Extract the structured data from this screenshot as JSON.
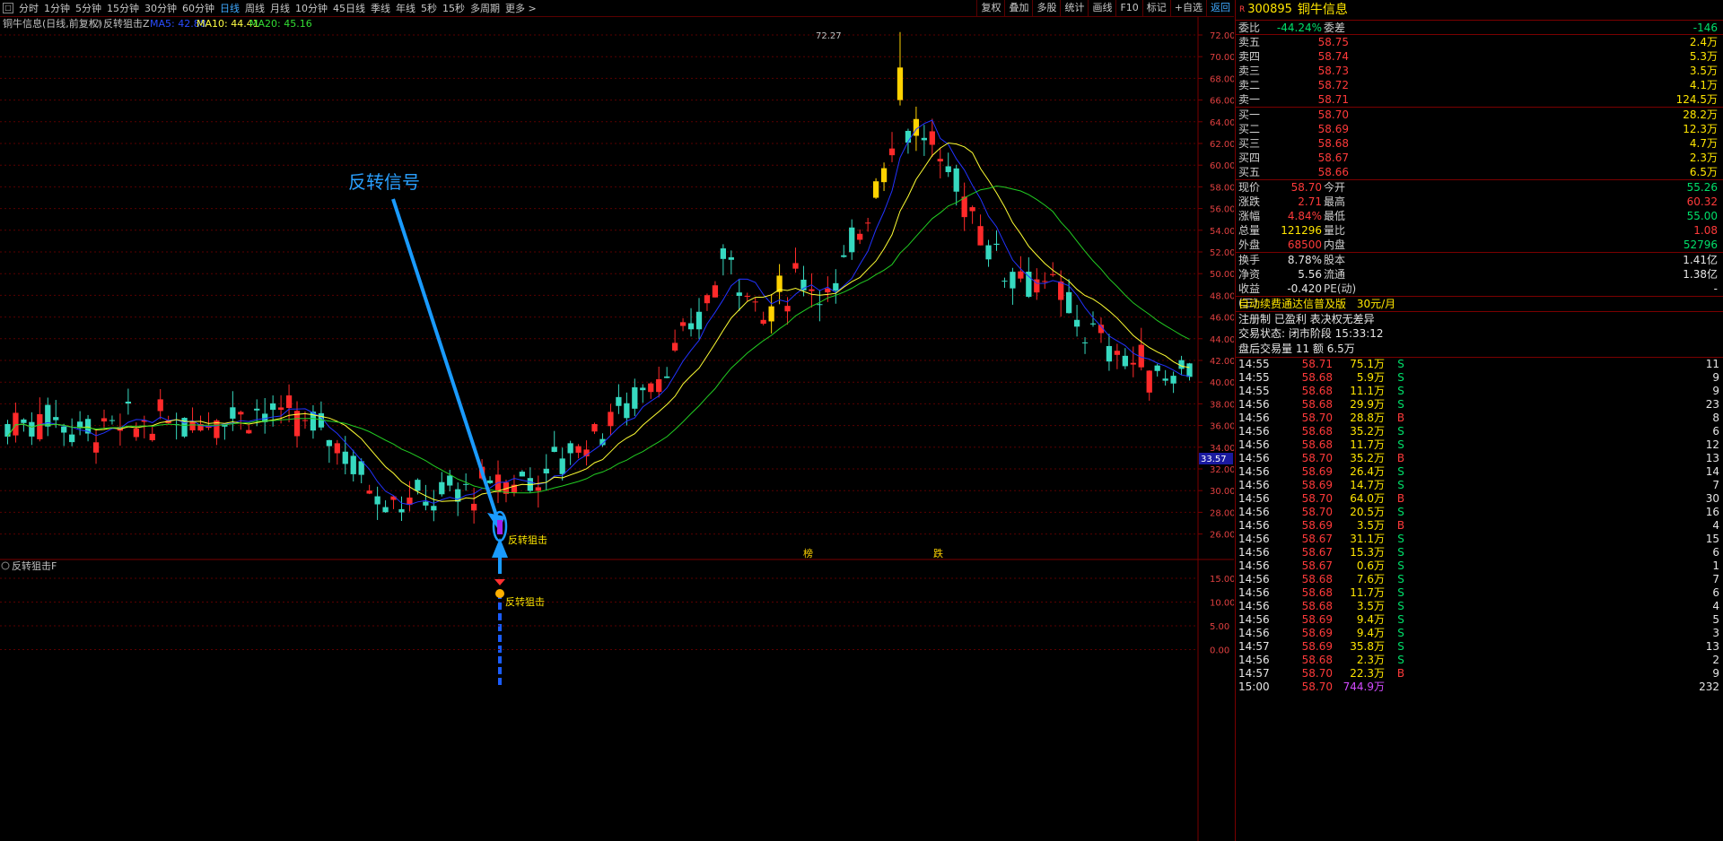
{
  "toolbar": {
    "period_tabs": [
      "分时",
      "1分钟",
      "5分钟",
      "15分钟",
      "30分钟",
      "60分钟",
      "日线",
      "周线",
      "月线",
      "10分钟",
      "45日线",
      "季线",
      "年线",
      "5秒",
      "15秒",
      "多周期",
      "更多 >"
    ],
    "active_tab": "日线",
    "right_buttons": [
      "复权",
      "叠加",
      "多股",
      "统计",
      "画线",
      "F10",
      "标记",
      "+自选",
      "返回"
    ]
  },
  "main_chart": {
    "header_title": "铜牛信息(日线,前复权)",
    "indicator_name": "反转狙击Z",
    "ma5": "MA5: 42.88",
    "ma10": "MA10: 44.41",
    "ma20": "MA20: 45.16",
    "high_label": "72.27",
    "price_axis": [
      "72.00",
      "70.00",
      "68.00",
      "66.00",
      "64.00",
      "62.00",
      "60.00",
      "58.00",
      "56.00",
      "54.00",
      "52.00",
      "50.00",
      "48.00",
      "46.00",
      "44.00",
      "42.00",
      "40.00",
      "38.00",
      "36.00",
      "34.00",
      "32.00",
      "30.00",
      "28.00",
      "26.00"
    ],
    "cursor_price": "33.57",
    "annotation_text": "反转信号",
    "signal_label": "反转狙击",
    "marker_bang": "榜",
    "marker_die": "跌",
    "colors": {
      "up": "#ff2a2a",
      "down": "#36d9c0",
      "limit_up": "#ffd200",
      "ma5": "#2233ff",
      "ma10": "#ffff33",
      "ma20": "#22cc22",
      "arrow": "#1a9bff"
    }
  },
  "sub_chart": {
    "title": "反转狙击F",
    "axis": [
      "15.00",
      "10.00",
      "5.00",
      "0.00"
    ],
    "signal_label": "反转狙击"
  },
  "panel": {
    "code": "300895",
    "name": "铜牛信息",
    "webi": {
      "label": "委比",
      "value": "-44.24%",
      "label2": "委差",
      "value2": "-146"
    },
    "sell": [
      {
        "label": "卖五",
        "price": "58.75",
        "vol": "2.4万"
      },
      {
        "label": "卖四",
        "price": "58.74",
        "vol": "5.3万"
      },
      {
        "label": "卖三",
        "price": "58.73",
        "vol": "3.5万"
      },
      {
        "label": "卖二",
        "price": "58.72",
        "vol": "4.1万"
      },
      {
        "label": "卖一",
        "price": "58.71",
        "vol": "124.5万"
      }
    ],
    "buy": [
      {
        "label": "买一",
        "price": "58.70",
        "vol": "28.2万"
      },
      {
        "label": "买二",
        "price": "58.69",
        "vol": "12.3万"
      },
      {
        "label": "买三",
        "price": "58.68",
        "vol": "4.7万"
      },
      {
        "label": "买四",
        "price": "58.67",
        "vol": "2.3万"
      },
      {
        "label": "买五",
        "price": "58.66",
        "vol": "6.5万"
      }
    ],
    "quote": [
      {
        "l1": "现价",
        "v1": "58.70",
        "l2": "今开",
        "v2": "55.26",
        "c1": "red",
        "c2": "grn"
      },
      {
        "l1": "涨跌",
        "v1": "2.71",
        "l2": "最高",
        "v2": "60.32",
        "c1": "red",
        "c2": "red"
      },
      {
        "l1": "涨幅",
        "v1": "4.84%",
        "l2": "最低",
        "v2": "55.00",
        "c1": "red",
        "c2": "grn"
      },
      {
        "l1": "总量",
        "v1": "121296",
        "l2": "量比",
        "v2": "1.08",
        "c1": "yel",
        "c2": "red"
      },
      {
        "l1": "外盘",
        "v1": "68500",
        "l2": "内盘",
        "v2": "52796",
        "c1": "red",
        "c2": "grn"
      }
    ],
    "fund": [
      {
        "l1": "换手",
        "v1": "8.78%",
        "l2": "股本",
        "v2": "1.41亿"
      },
      {
        "l1": "净资",
        "v1": "5.56",
        "l2": "流通",
        "v2": "1.38亿"
      },
      {
        "l1": "收益(三)",
        "v1": "-0.420",
        "l2": "PE(动)",
        "v2": "-"
      }
    ],
    "promo": "自动续费通达信普及版",
    "promo_price": "30元/月",
    "reg_info": "注册制 已盈利 表决权无差异",
    "trade_state": "交易状态: 闭市阶段 15:33:12",
    "after_hours": "盘后交易量 11 额 6.5万",
    "ticks": [
      {
        "t": "14:55",
        "p": "58.71",
        "a": "75.1万",
        "s": "S",
        "n": "11"
      },
      {
        "t": "14:55",
        "p": "58.68",
        "a": "5.9万",
        "s": "S",
        "n": "9"
      },
      {
        "t": "14:55",
        "p": "58.68",
        "a": "11.1万",
        "s": "S",
        "n": "9"
      },
      {
        "t": "14:56",
        "p": "58.68",
        "a": "29.9万",
        "s": "S",
        "n": "23"
      },
      {
        "t": "14:56",
        "p": "58.70",
        "a": "28.8万",
        "s": "B",
        "n": "8"
      },
      {
        "t": "14:56",
        "p": "58.68",
        "a": "35.2万",
        "s": "S",
        "n": "6"
      },
      {
        "t": "14:56",
        "p": "58.68",
        "a": "11.7万",
        "s": "S",
        "n": "12"
      },
      {
        "t": "14:56",
        "p": "58.70",
        "a": "35.2万",
        "s": "B",
        "n": "13"
      },
      {
        "t": "14:56",
        "p": "58.69",
        "a": "26.4万",
        "s": "S",
        "n": "14"
      },
      {
        "t": "14:56",
        "p": "58.69",
        "a": "14.7万",
        "s": "S",
        "n": "7"
      },
      {
        "t": "14:56",
        "p": "58.70",
        "a": "64.0万",
        "s": "B",
        "n": "30"
      },
      {
        "t": "14:56",
        "p": "58.70",
        "a": "20.5万",
        "s": "S",
        "n": "16"
      },
      {
        "t": "14:56",
        "p": "58.69",
        "a": "3.5万",
        "s": "B",
        "n": "4"
      },
      {
        "t": "14:56",
        "p": "58.67",
        "a": "31.1万",
        "s": "S",
        "n": "15"
      },
      {
        "t": "14:56",
        "p": "58.67",
        "a": "15.3万",
        "s": "S",
        "n": "6"
      },
      {
        "t": "14:56",
        "p": "58.67",
        "a": "0.6万",
        "s": "S",
        "n": "1"
      },
      {
        "t": "14:56",
        "p": "58.68",
        "a": "7.6万",
        "s": "S",
        "n": "7"
      },
      {
        "t": "14:56",
        "p": "58.68",
        "a": "11.7万",
        "s": "S",
        "n": "6"
      },
      {
        "t": "14:56",
        "p": "58.68",
        "a": "3.5万",
        "s": "S",
        "n": "4"
      },
      {
        "t": "14:56",
        "p": "58.69",
        "a": "9.4万",
        "s": "S",
        "n": "5"
      },
      {
        "t": "14:56",
        "p": "58.69",
        "a": "9.4万",
        "s": "S",
        "n": "3"
      },
      {
        "t": "14:57",
        "p": "58.69",
        "a": "35.8万",
        "s": "S",
        "n": "13"
      },
      {
        "t": "14:56",
        "p": "58.68",
        "a": "2.3万",
        "s": "S",
        "n": "2"
      },
      {
        "t": "14:57",
        "p": "58.70",
        "a": "22.3万",
        "s": "B",
        "n": "9"
      },
      {
        "t": "15:00",
        "p": "58.70",
        "a": "744.9万",
        "s": "",
        "n": "232"
      }
    ]
  }
}
